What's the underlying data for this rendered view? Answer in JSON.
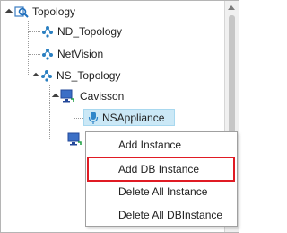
{
  "tree": {
    "root": {
      "label": "Topology",
      "icon": "topology-search-icon"
    },
    "items": [
      {
        "label": "ND_Topology",
        "icon": "topology-nodes-icon"
      },
      {
        "label": "NetVision",
        "icon": "topology-nodes-icon"
      },
      {
        "label": "NS_Topology",
        "icon": "topology-nodes-icon"
      },
      {
        "label": "Cavisson",
        "icon": "monitor-icon"
      },
      {
        "label": "NSAppliance",
        "icon": "microphone-icon"
      }
    ]
  },
  "context_menu": {
    "items": [
      {
        "label": "Add Instance"
      },
      {
        "label": "Add DB Instance"
      },
      {
        "label": "Delete All Instance"
      },
      {
        "label": "Delete All DBInstance"
      }
    ],
    "highlight_color": "#e01b24"
  },
  "colors": {
    "selection": "#cbe8f6",
    "icon_blue": "#2a7fc1"
  }
}
